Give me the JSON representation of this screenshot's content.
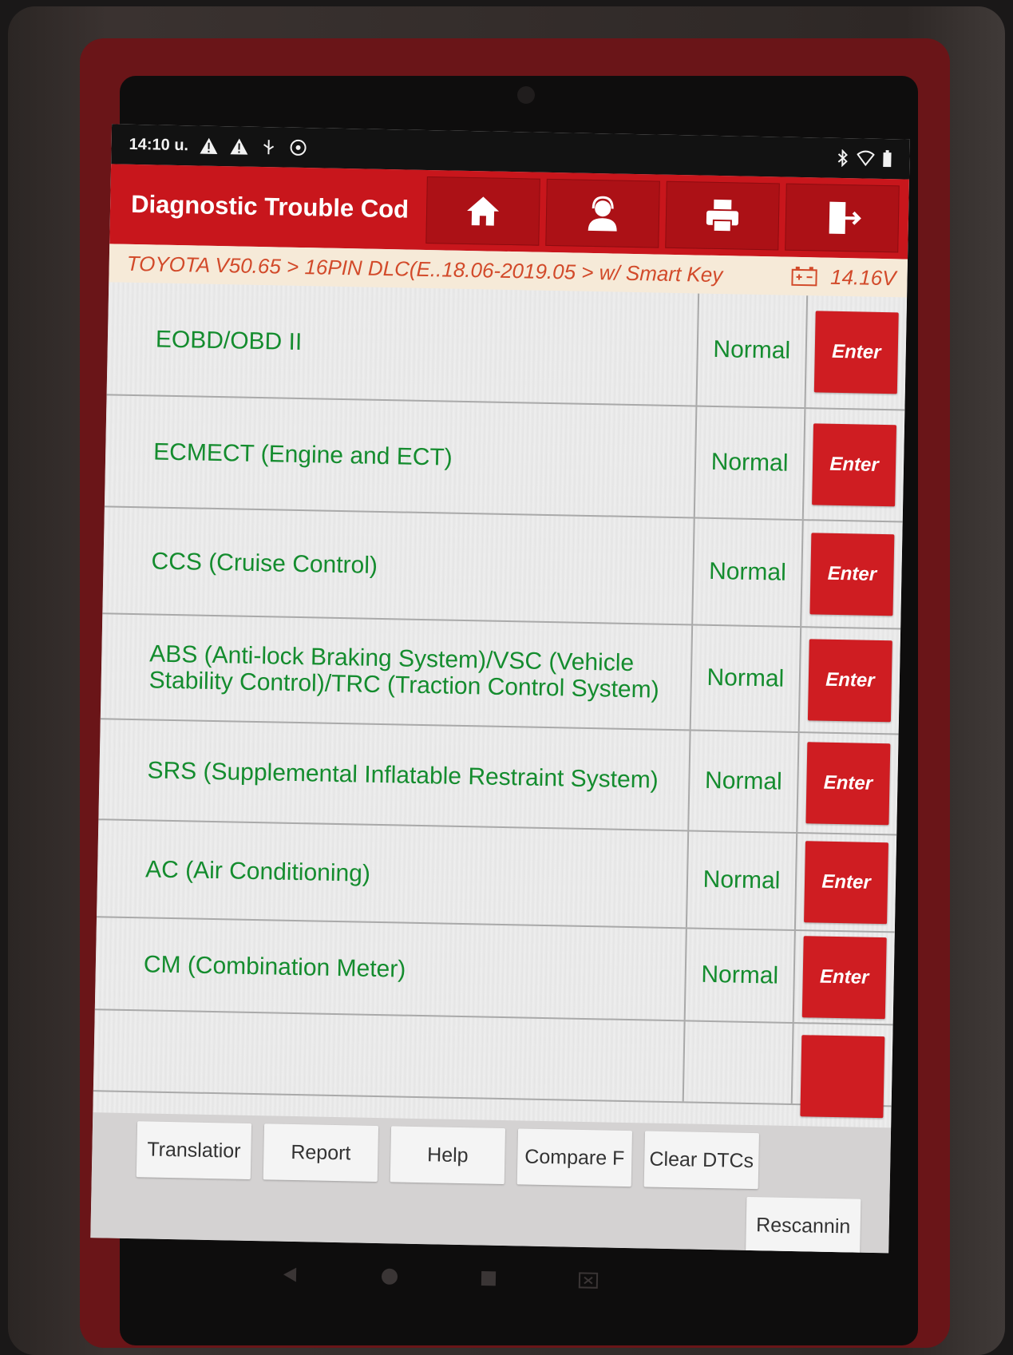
{
  "status_bar": {
    "time": "14:10 u.",
    "left_icons": [
      "warning-icon",
      "warning-icon",
      "usb-icon",
      "settings-icon"
    ],
    "right_icons": [
      "bluetooth-icon",
      "wifi-icon",
      "battery-icon"
    ]
  },
  "header": {
    "title": "Diagnostic Trouble Cod",
    "nav_buttons": [
      "home-icon",
      "support-icon",
      "print-icon",
      "exit-icon"
    ]
  },
  "breadcrumb": {
    "path": "TOYOTA V50.65 > 16PIN DLC(E..18.06-2019.05 > w/ Smart Key",
    "voltage": "14.16V"
  },
  "systems": [
    {
      "name": "EOBD/OBD II",
      "status": "Normal",
      "action": "Enter"
    },
    {
      "name": "ECMECT (Engine and ECT)",
      "status": "Normal",
      "action": "Enter"
    },
    {
      "name": "CCS (Cruise Control)",
      "status": "Normal",
      "action": "Enter"
    },
    {
      "name": "ABS (Anti-lock Braking System)/VSC (Vehicle Stability Control)/TRC (Traction Control System)",
      "status": "Normal",
      "action": "Enter"
    },
    {
      "name": "SRS (Supplemental Inflatable Restraint System)",
      "status": "Normal",
      "action": "Enter"
    },
    {
      "name": "AC (Air Conditioning)",
      "status": "Normal",
      "action": "Enter"
    },
    {
      "name": "CM (Combination Meter)",
      "status": "Normal",
      "action": "Enter"
    }
  ],
  "toolbar": {
    "translation": "Translatior",
    "report": "Report",
    "help": "Help",
    "compare": "Compare F",
    "clear_dtcs": "Clear DTCs",
    "rescanning": "Rescannin"
  },
  "colors": {
    "brand_red": "#c8161c",
    "status_green": "#148c2e",
    "breadcrumb_text": "#d24a2a"
  }
}
